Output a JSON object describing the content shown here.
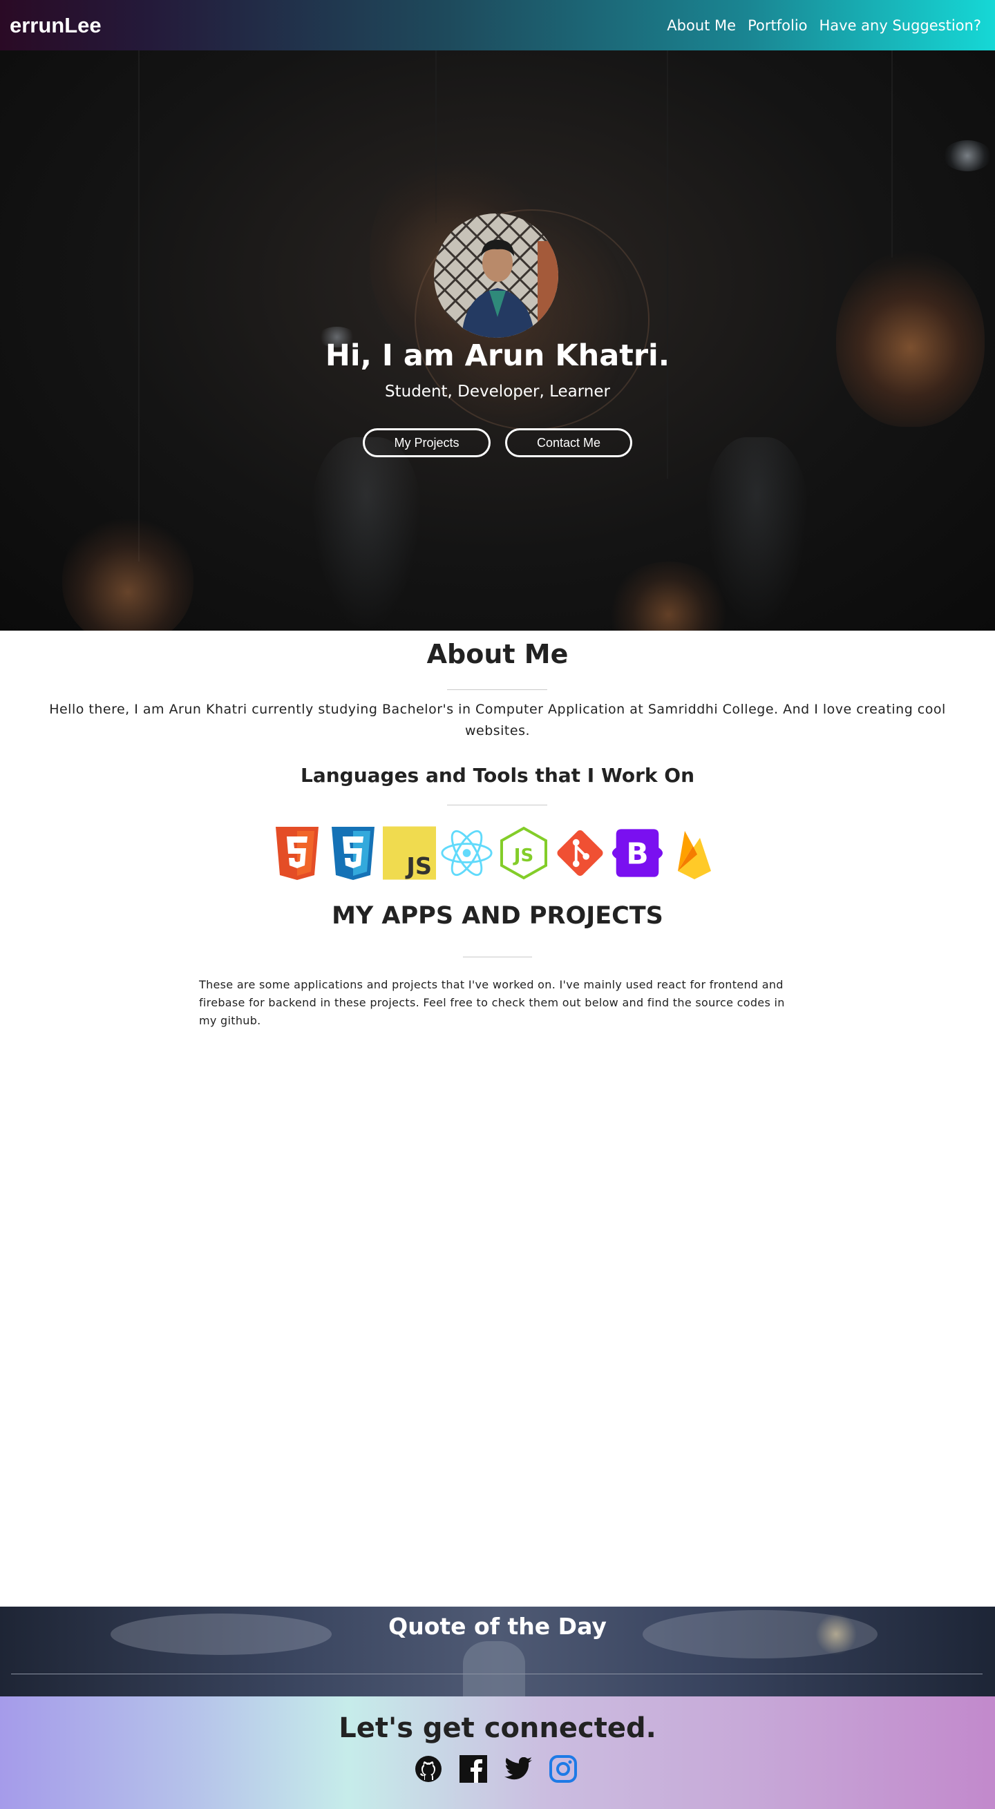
{
  "navbar": {
    "brand": "errunLee",
    "links": [
      "About Me",
      "Portfolio",
      "Have any Suggestion?"
    ]
  },
  "hero": {
    "title": "Hi, I am Arun Khatri.",
    "subtitle": "Student, Developer, Learner",
    "buttons": [
      "My Projects",
      "Contact Me"
    ]
  },
  "about": {
    "title": "About Me",
    "text": "Hello there, I am Arun Khatri currently studying Bachelor's in Computer Application at Samriddhi College. And I love creating cool websites."
  },
  "tools": {
    "title": "Languages and Tools that I Work On",
    "icons": [
      "html5-icon",
      "css3-icon",
      "javascript-icon",
      "react-icon",
      "nodejs-icon",
      "git-icon",
      "bootstrap-icon",
      "firebase-icon"
    ]
  },
  "projects": {
    "title": "MY APPS AND PROJECTS",
    "text": "These are some applications and projects that I've worked on. I've mainly used react for frontend and firebase for backend in these projects. Feel free to check them out below and find the source codes in my github."
  },
  "quote": {
    "title": "Quote of the Day"
  },
  "footer": {
    "title": "Let's get connected.",
    "social": [
      "github-icon",
      "facebook-icon",
      "twitter-icon",
      "instagram-icon"
    ]
  }
}
